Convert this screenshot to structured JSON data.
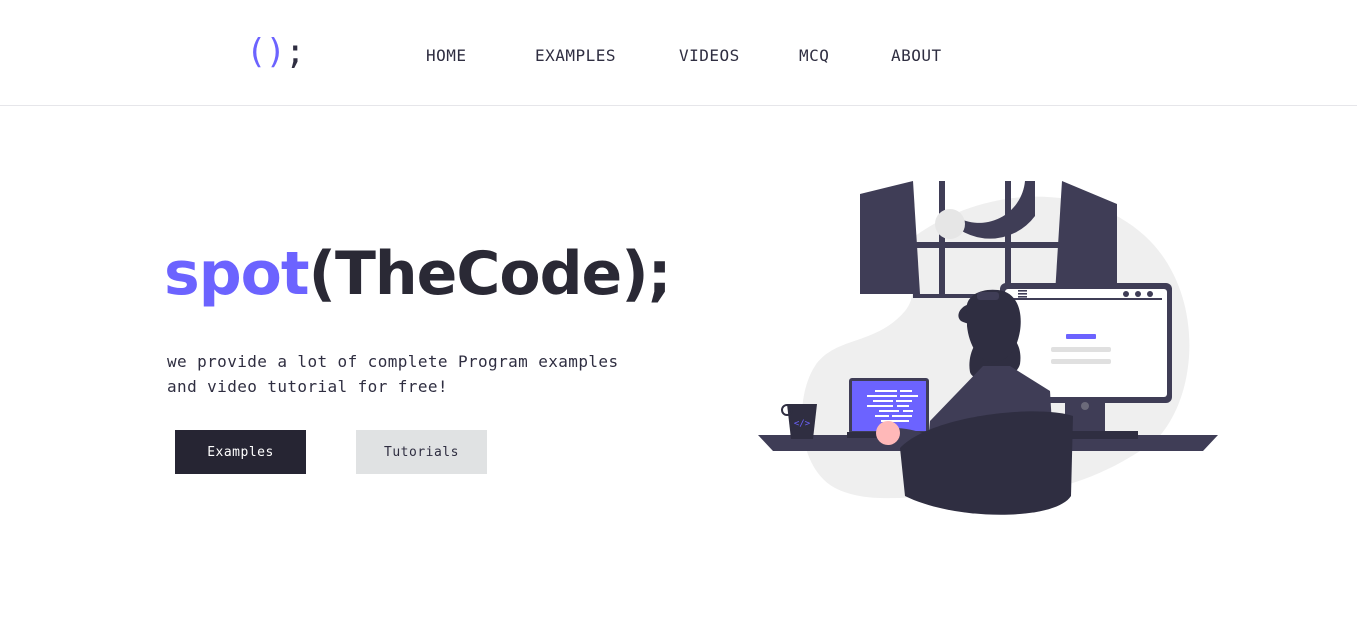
{
  "brand": {
    "logo_open": "()",
    "logo_close": ";"
  },
  "nav": {
    "items": [
      {
        "label": "HOME"
      },
      {
        "label": "EXAMPLES"
      },
      {
        "label": "VIDEOS"
      },
      {
        "label": "MCQ"
      },
      {
        "label": "ABOUT"
      }
    ]
  },
  "hero": {
    "title_accent": "spot",
    "title_rest": "(TheCode);",
    "tagline_line1": "we provide a lot of complete Program examples",
    "tagline_line2": "and video tutorial for free!",
    "primary_button": "Examples",
    "secondary_button": "Tutorials"
  },
  "illustration": {
    "laptop_code_icon": "</>",
    "monitor_menu_icon": "hamburger-icon"
  },
  "colors": {
    "accent": "#6c63ff",
    "dark": "#2f2e41",
    "button_dark": "#262533",
    "button_light": "#e0e2e3"
  }
}
